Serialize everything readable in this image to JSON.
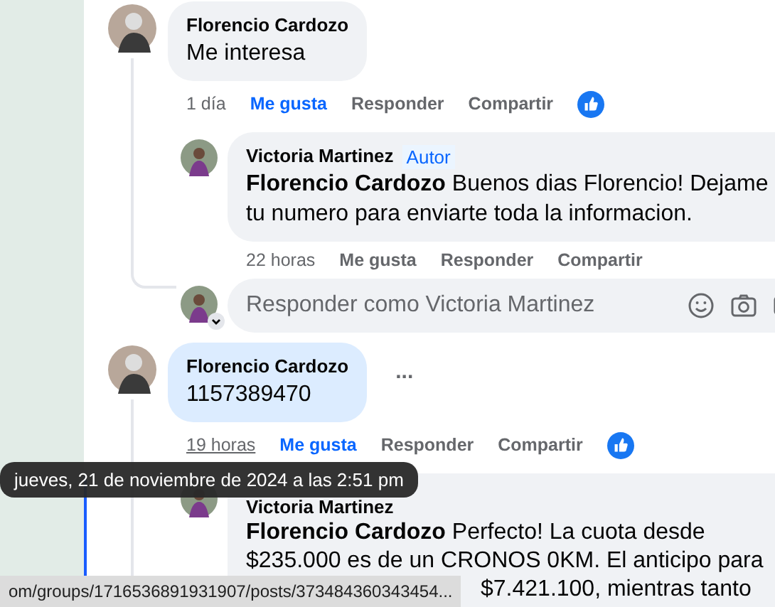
{
  "comments": [
    {
      "author": "Florencio Cardozo",
      "text": "Me interesa",
      "highlighted": false,
      "time": "1 día",
      "time_hovered": false,
      "liked": true,
      "actions": [
        "Me gusta",
        "Responder",
        "Compartir"
      ],
      "has_reaction": true,
      "has_menu": false,
      "replies": [
        {
          "author": "Victoria Martinez",
          "badge": "Autor",
          "text": "**Florencio Cardozo** Buenos dias Florencio! Dejame tu numero para enviarte toda la informacion.",
          "time": "22 horas",
          "liked": false,
          "actions": [
            "Me gusta",
            "Responder",
            "Compartir"
          ]
        }
      ],
      "reply_field": {
        "placeholder": "Responder como Victoria Martinez"
      }
    },
    {
      "author": "Florencio Cardozo",
      "text": "1157389470",
      "highlighted": true,
      "time": "19 horas",
      "time_hovered": true,
      "liked": true,
      "actions": [
        "Me gusta",
        "Responder",
        "Compartir"
      ],
      "has_reaction": true,
      "has_menu": true,
      "menu_label": "...",
      "replies": [
        {
          "author": "Victoria Martinez",
          "text": "**Florencio Cardozo** Perfecto! La cuota desde $235.000 es de un CRONOS 0KM. El anticipo para",
          "text_continued": "$7.421.100, mientras tanto"
        }
      ]
    }
  ],
  "tooltip": "jueves, 21 de noviembre de 2024 a las 2:51 pm",
  "status_bar": "om/groups/1716536891931907/posts/373484360343454..."
}
